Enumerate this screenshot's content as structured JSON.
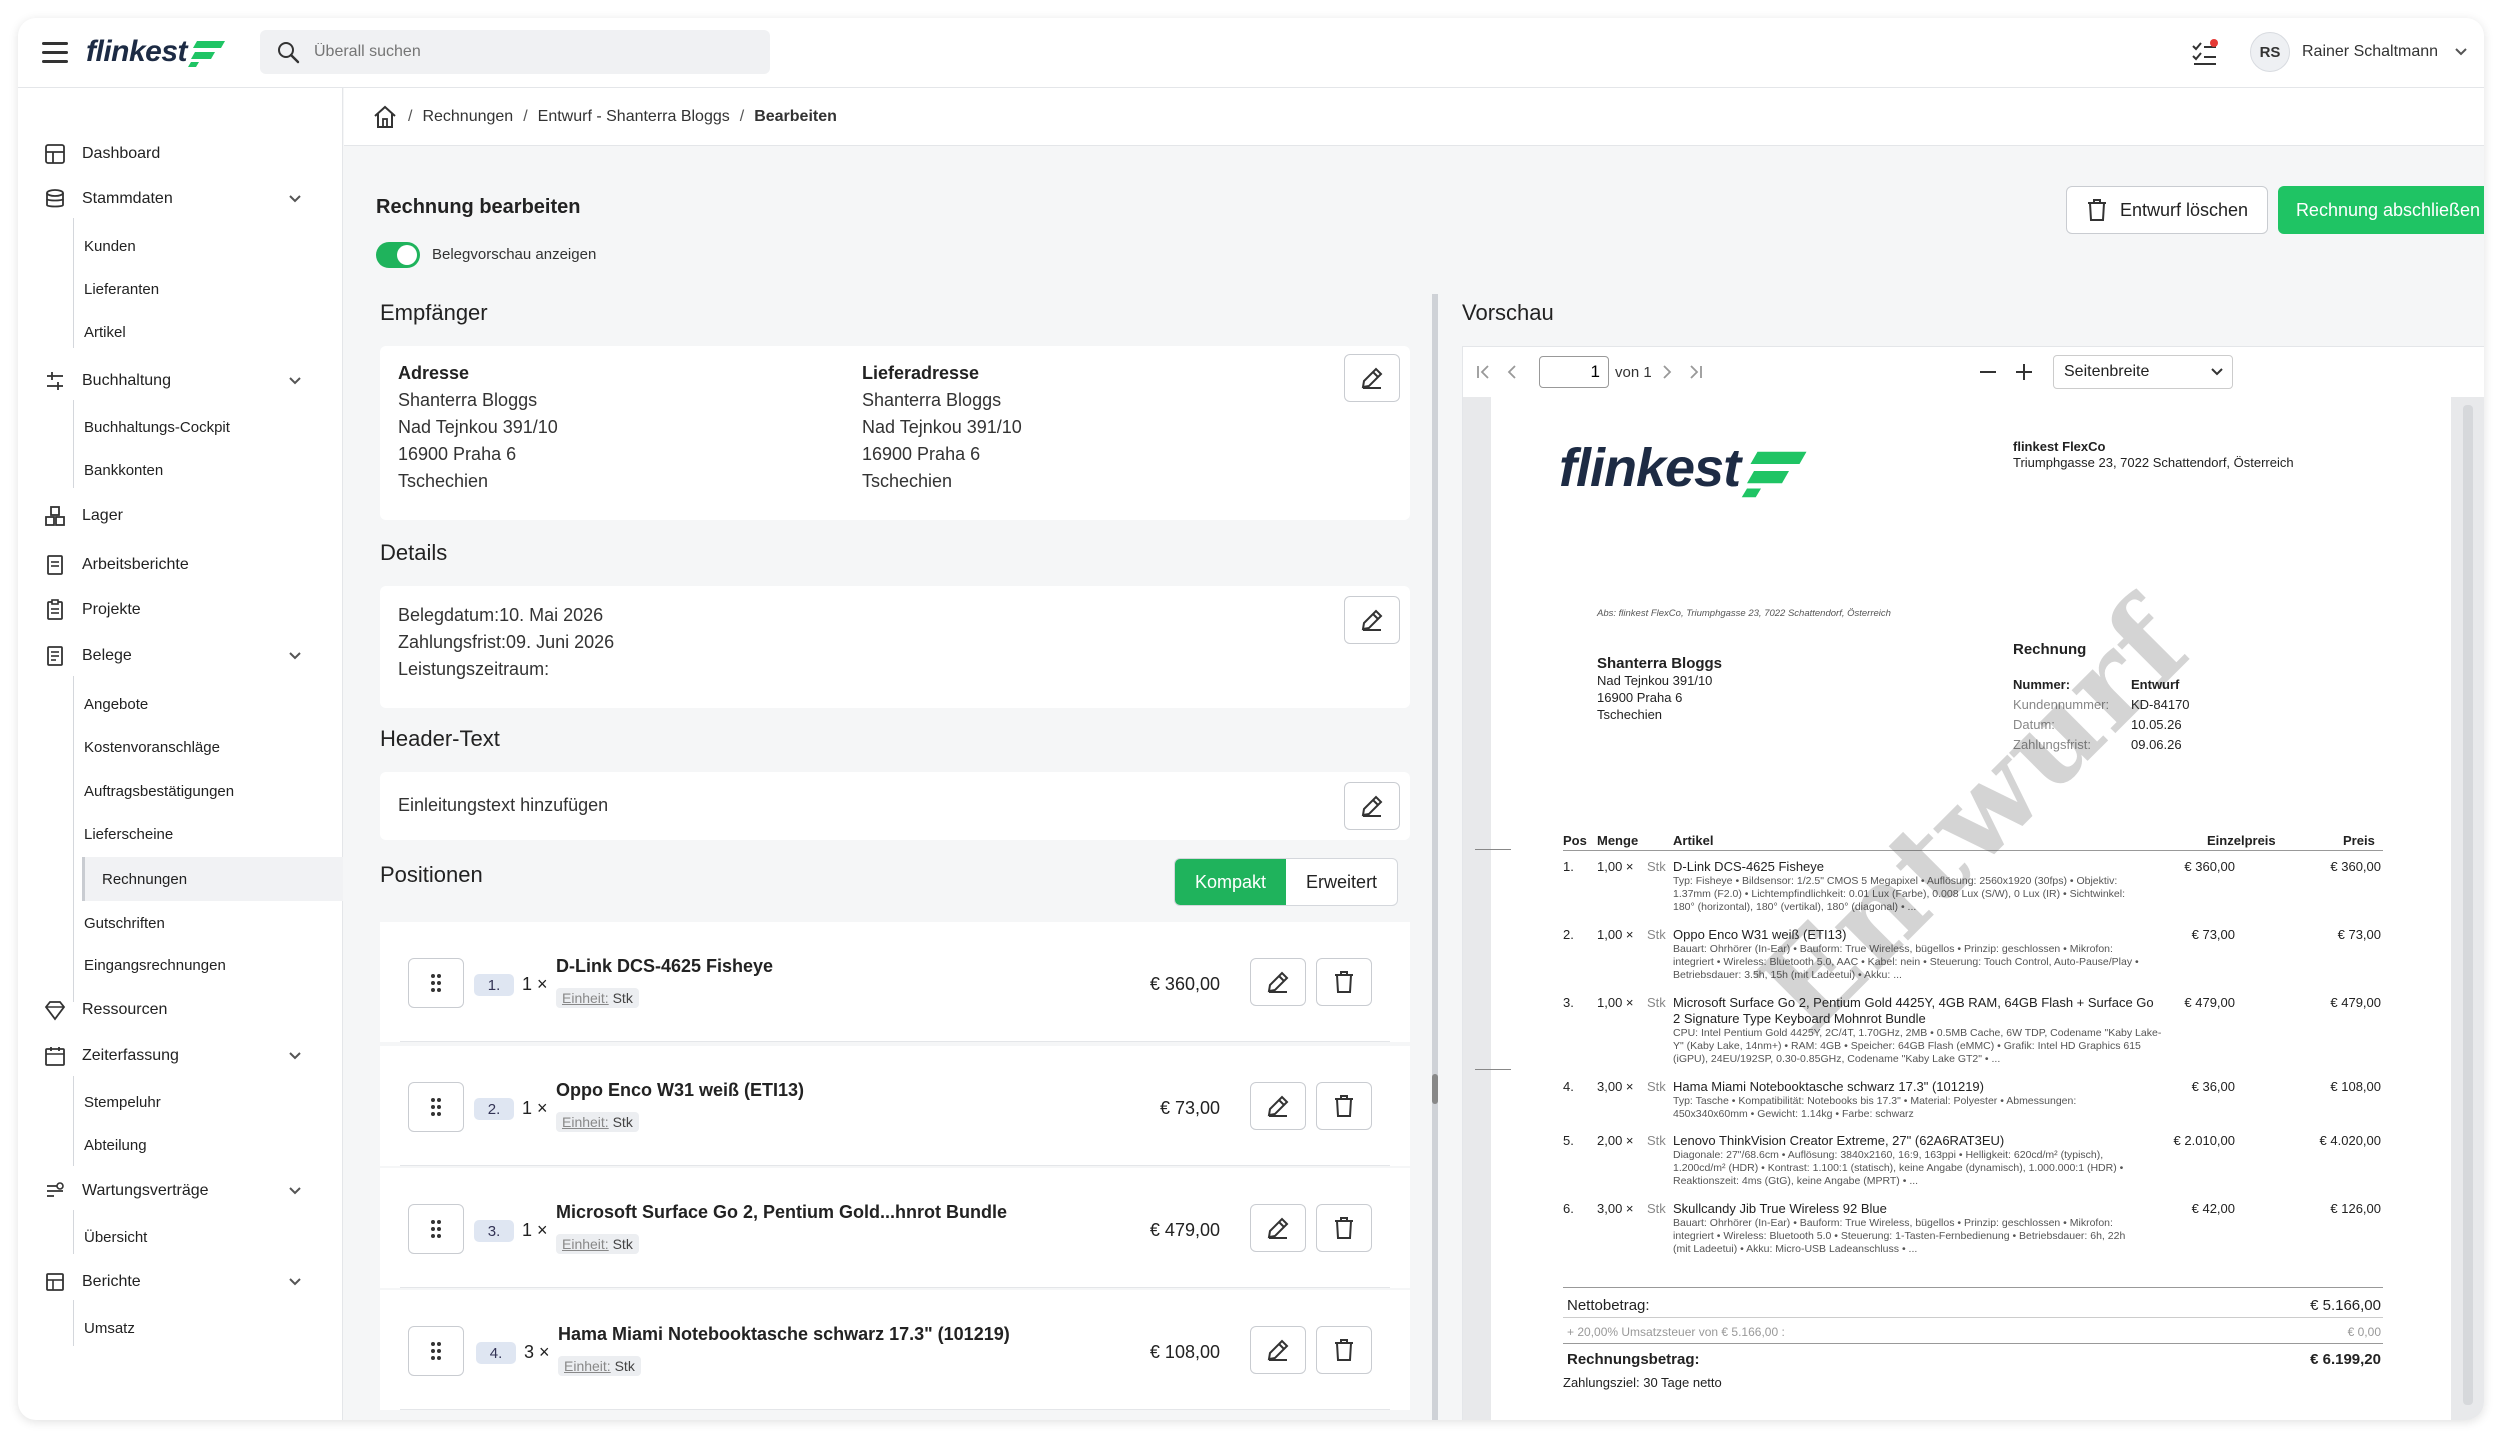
{
  "app": {
    "logo_text": "flinkest"
  },
  "search": {
    "placeholder": "Überall suchen"
  },
  "user": {
    "initials": "RS",
    "name": "Rainer Schaltmann"
  },
  "sidebar": {
    "items": [
      {
        "label": "Dashboard"
      },
      {
        "label": "Stammdaten"
      },
      {
        "label": "Kunden"
      },
      {
        "label": "Lieferanten"
      },
      {
        "label": "Artikel"
      },
      {
        "label": "Buchhaltung"
      },
      {
        "label": "Buchhaltungs-Cockpit"
      },
      {
        "label": "Bankkonten"
      },
      {
        "label": "Lager"
      },
      {
        "label": "Arbeitsberichte"
      },
      {
        "label": "Projekte"
      },
      {
        "label": "Belege"
      },
      {
        "label": "Angebote"
      },
      {
        "label": "Kostenvoranschläge"
      },
      {
        "label": "Auftragsbestätigungen"
      },
      {
        "label": "Lieferscheine"
      },
      {
        "label": "Rechnungen"
      },
      {
        "label": "Gutschriften"
      },
      {
        "label": "Eingangsrechnungen"
      },
      {
        "label": "Ressourcen"
      },
      {
        "label": "Zeiterfassung"
      },
      {
        "label": "Stempeluhr"
      },
      {
        "label": "Abteilung"
      },
      {
        "label": "Wartungsverträge"
      },
      {
        "label": "Übersicht"
      },
      {
        "label": "Berichte"
      },
      {
        "label": "Umsatz"
      }
    ]
  },
  "breadcrumb": {
    "items": [
      "Rechnungen",
      "Entwurf - Shanterra Bloggs",
      "Bearbeiten"
    ]
  },
  "page": {
    "title": "Rechnung bearbeiten",
    "toggle_label": "Belegvorschau anzeigen",
    "delete_label": "Entwurf löschen",
    "finish_label": "Rechnung abschließen"
  },
  "recipient": {
    "section": "Empfänger",
    "address_title": "Adresse",
    "address_lines": [
      "Shanterra Bloggs",
      "Nad Tejnkou 391/10",
      "16900 Praha 6",
      "Tschechien"
    ],
    "delivery_title": "Lieferadresse",
    "delivery_lines": [
      "Shanterra Bloggs",
      "Nad Tejnkou 391/10",
      "16900 Praha 6",
      "Tschechien"
    ]
  },
  "details": {
    "section": "Details",
    "belegdatum": "Belegdatum:10. Mai 2026",
    "zahlungsfrist": "Zahlungsfrist:09. Juni 2026",
    "leistungszeitraum": "Leistungszeitraum:"
  },
  "header_text": {
    "section": "Header-Text",
    "placeholder": "Einleitungstext hinzufügen"
  },
  "positions": {
    "section": "Positionen",
    "mode_compact": "Kompakt",
    "mode_extended": "Erweitert",
    "unit_label": "Einheit:",
    "rows": [
      {
        "num": "1.",
        "qty": "1 ×",
        "name": "D-Link DCS-4625 Fisheye",
        "unit": "Stk",
        "price": "€ 360,00"
      },
      {
        "num": "2.",
        "qty": "1 ×",
        "name": "Oppo Enco W31 weiß (ETI13)",
        "unit": "Stk",
        "price": "€ 73,00"
      },
      {
        "num": "3.",
        "qty": "1 ×",
        "name": "Microsoft Surface Go 2, Pentium Gold...hnrot Bundle",
        "unit": "Stk",
        "price": "€ 479,00"
      },
      {
        "num": "4.",
        "qty": "3 ×",
        "name": "Hama Miami Notebooktasche schwarz 17.3\" (101219)",
        "unit": "Stk",
        "price": "€ 108,00"
      }
    ]
  },
  "preview": {
    "title": "Vorschau",
    "page_value": "1",
    "page_of": "von 1",
    "zoom": "Seitenbreite",
    "doc": {
      "logo": "flinkest",
      "company": "flinkest FlexCo",
      "company_addr": "Triumphgasse 23, 7022 Schattendorf, Österreich",
      "sender_line": "Abs: flinkest FlexCo, Triumphgasse 23, 7022 Schattendorf, Österreich",
      "rec_name": "Shanterra Bloggs",
      "rec_lines": [
        "Nad Tejnkou 391/10",
        "16900 Praha 6",
        "Tschechien"
      ],
      "doc_type": "Rechnung",
      "meta": [
        {
          "k": "Nummer:",
          "v": "Entwurf"
        },
        {
          "k": "Kundennummer:",
          "v": "KD-84170"
        },
        {
          "k": "Datum:",
          "v": "10.05.26"
        },
        {
          "k": "Zahlungsfrist:",
          "v": "09.06.26"
        }
      ],
      "cols": {
        "pos": "Pos",
        "qty": "Menge",
        "item": "Artikel",
        "unit_price": "Einzelpreis",
        "price": "Preis"
      },
      "lines": [
        {
          "pos": "1.",
          "qty": "1,00 ×",
          "unit": "Stk",
          "title": "D-Link DCS-4625 Fisheye",
          "desc": [
            "Typ: Fisheye • Bildsensor: 1/2.5\" CMOS 5 Megapixel • Auflösung: 2560x1920 (30fps) • Objektiv:",
            "1.37mm (F2.0) • Lichtempfindlichkeit: 0.01 Lux (Farbe), 0.008 Lux (S/W), 0 Lux (IR) • Sichtwinkel:",
            "180° (horizontal), 180° (vertikal), 180° (diagonal) • ..."
          ],
          "up": "€ 360,00",
          "p": "€ 360,00"
        },
        {
          "pos": "2.",
          "qty": "1,00 ×",
          "unit": "Stk",
          "title": "Oppo Enco W31 weiß (ETI13)",
          "desc": [
            "Bauart: Ohrhörer (In-Ear) • Bauform: True Wireless, bügellos • Prinzip: geschlossen • Mikrofon:",
            "integriert • Wireless: Bluetooth 5.0, AAC • Kabel: nein • Steuerung: Touch Control, Auto-Pause/Play •",
            "Betriebsdauer: 3.5h, 15h (mit Ladeetui) • Akku: ..."
          ],
          "up": "€ 73,00",
          "p": "€ 73,00"
        },
        {
          "pos": "3.",
          "qty": "1,00 ×",
          "unit": "Stk",
          "title": "Microsoft Surface Go 2, Pentium Gold 4425Y, 4GB RAM, 64GB Flash + Surface Go",
          "title2": "2 Signature Type Keyboard Mohnrot Bundle",
          "desc": [
            "CPU: Intel Pentium Gold 4425Y, 2C/4T, 1.70GHz, 2MB • 0.5MB Cache, 6W TDP, Codename \"Kaby Lake-",
            "Y\" (Kaby Lake, 14nm+) • RAM: 4GB • Speicher: 64GB Flash (eMMC) • Grafik: Intel HD Graphics 615",
            "(iGPU), 24EU/192SP, 0.30-0.85GHz, Codename \"Kaby Lake GT2\" • ..."
          ],
          "up": "€ 479,00",
          "p": "€ 479,00"
        },
        {
          "pos": "4.",
          "qty": "3,00 ×",
          "unit": "Stk",
          "title": "Hama Miami Notebooktasche schwarz 17.3\" (101219)",
          "desc": [
            "Typ: Tasche • Kompatibilität: Notebooks bis 17.3\" • Material: Polyester • Abmessungen:",
            "450x340x60mm • Gewicht: 1.14kg • Farbe: schwarz"
          ],
          "up": "€ 36,00",
          "p": "€ 108,00"
        },
        {
          "pos": "5.",
          "qty": "2,00 ×",
          "unit": "Stk",
          "title": "Lenovo ThinkVision Creator Extreme, 27\" (62A6RAT3EU)",
          "desc": [
            "Diagonale: 27\"/68.6cm • Auflösung: 3840x2160, 16:9, 163ppi • Helligkeit: 620cd/m² (typisch),",
            "1.200cd/m² (HDR) • Kontrast: 1.100:1 (statisch), keine Angabe (dynamisch), 1.000.000:1 (HDR) •",
            "Reaktionszeit: 4ms (GtG), keine Angabe (MPRT) • ..."
          ],
          "up": "€ 2.010,00",
          "p": "€ 4.020,00"
        },
        {
          "pos": "6.",
          "qty": "3,00 ×",
          "unit": "Stk",
          "title": "Skullcandy Jib True Wireless 92 Blue",
          "desc": [
            "Bauart: Ohrhörer (In-Ear) • Bauform: True Wireless, bügellos • Prinzip: geschlossen • Mikrofon:",
            "integriert • Wireless: Bluetooth 5.0 • Steuerung: 1-Tasten-Fernbedienung • Betriebsdauer: 6h, 22h",
            "(mit Ladeetui) • Akku: Micro-USB Ladeanschluss • ..."
          ],
          "up": "€ 42,00",
          "p": "€ 126,00"
        }
      ],
      "net_label": "Nettobetrag:",
      "net_value": "€ 5.166,00",
      "vat_label": "+ 20,00% Umsatzsteuer von € 5.166,00 :",
      "vat_value": "€ 0,00",
      "total_label": "Rechnungsbetrag:",
      "total_value": "€ 6.199,20",
      "payment_terms": "Zahlungsziel: 30 Tage netto",
      "watermark": "Entwurf"
    }
  },
  "colors": {
    "accent": "#1fc464",
    "toggle": "#1fb35c",
    "logo_dark": "#1d2b44"
  }
}
